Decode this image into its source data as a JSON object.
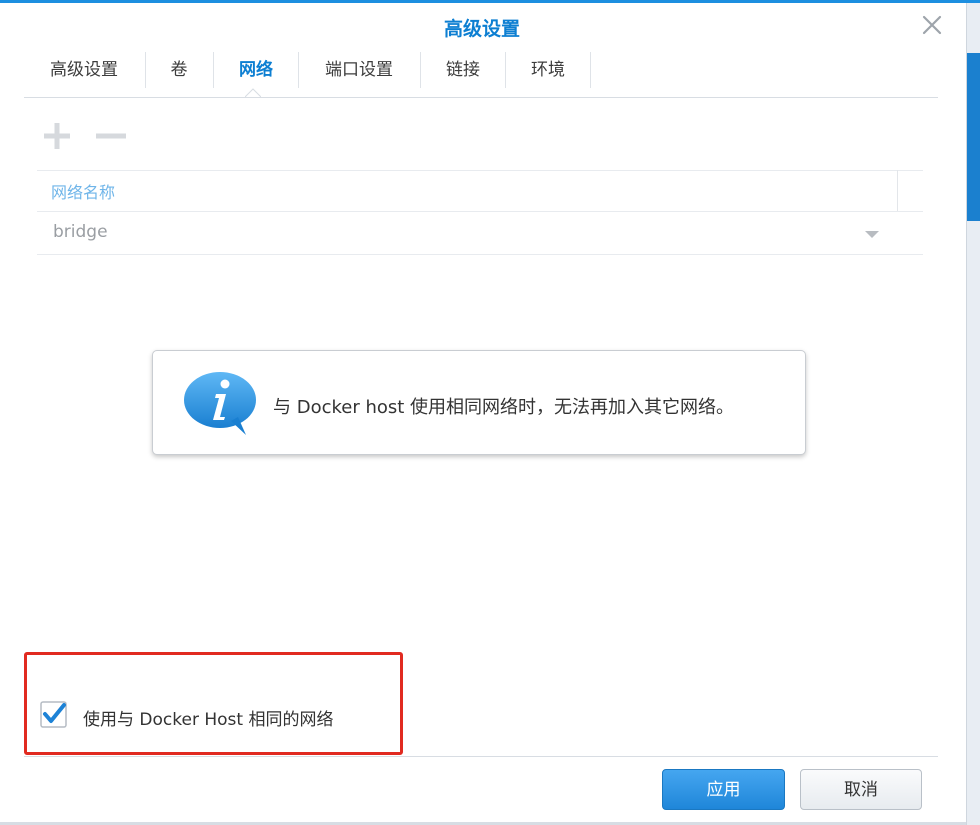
{
  "dialog": {
    "title": "高级设置"
  },
  "tabs": [
    {
      "label": "高级设置",
      "active": false
    },
    {
      "label": "卷",
      "active": false
    },
    {
      "label": "网络",
      "active": true
    },
    {
      "label": "端口设置",
      "active": false
    },
    {
      "label": "链接",
      "active": false
    },
    {
      "label": "环境",
      "active": false
    }
  ],
  "toolbar": {
    "add_icon": "plus-icon",
    "remove_icon": "minus-icon"
  },
  "network_table": {
    "columns": [
      "网络名称"
    ],
    "rows": [
      {
        "name": "bridge"
      }
    ]
  },
  "info_message": "与 Docker host 使用相同网络时，无法再加入其它网络。",
  "use_host_network": {
    "label": "使用与 Docker Host 相同的网络",
    "checked": true
  },
  "buttons": {
    "apply": "应用",
    "cancel": "取消"
  },
  "colors": {
    "accent": "#0d7fd2",
    "highlight_box": "#e12a20",
    "primary_button": "#2993e6"
  }
}
